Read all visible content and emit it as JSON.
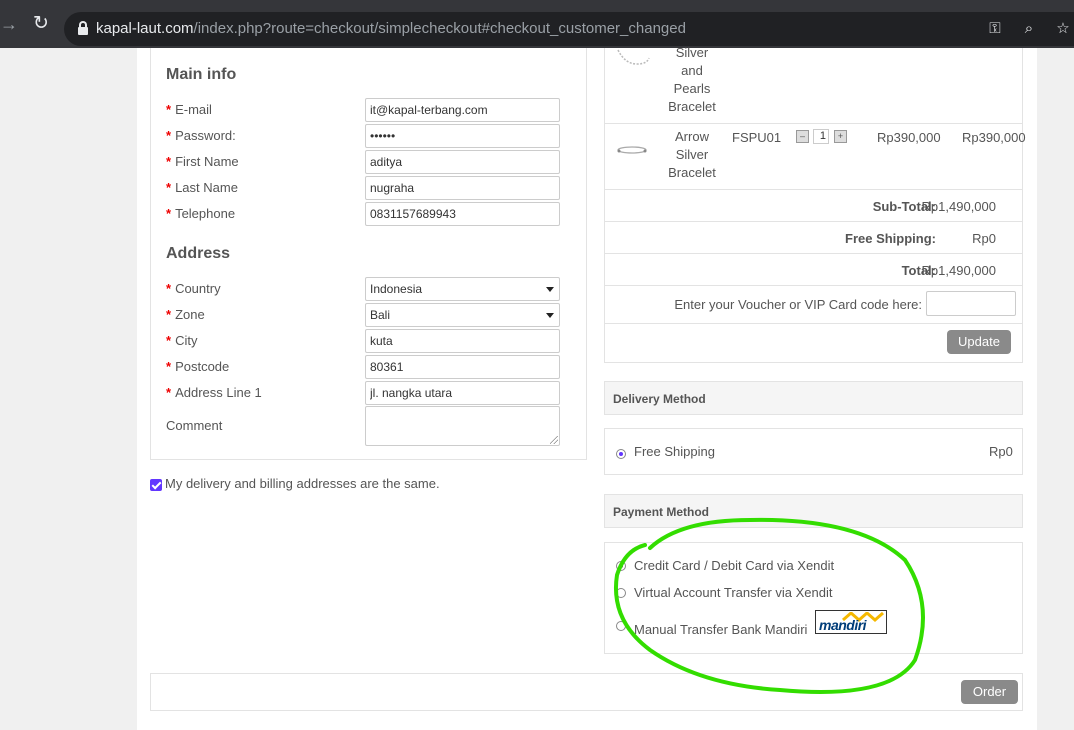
{
  "browser": {
    "url_host": "kapal-laut.com",
    "url_path": "/index.php?route=checkout/simplecheckout#checkout_customer_changed"
  },
  "main_info": {
    "title": "Main info",
    "fields": [
      {
        "label": "E-mail",
        "value": "it@kapal-terbang.com",
        "required": true
      },
      {
        "label": "Password:",
        "value": "••••••",
        "required": true
      },
      {
        "label": "First Name",
        "value": "aditya",
        "required": true
      },
      {
        "label": "Last Name",
        "value": "nugraha",
        "required": true
      },
      {
        "label": "Telephone",
        "value": "0831157689943",
        "required": true
      }
    ]
  },
  "address": {
    "title": "Address",
    "country": {
      "label": "Country",
      "value": "Indonesia"
    },
    "zone": {
      "label": "Zone",
      "value": "Bali"
    },
    "city": {
      "label": "City",
      "value": "kuta"
    },
    "postcode": {
      "label": "Postcode",
      "value": "80361"
    },
    "address1": {
      "label": "Address Line 1",
      "value": "jl. nangka utara"
    },
    "comment": {
      "label": "Comment",
      "value": ""
    }
  },
  "same_address": {
    "label": "My delivery and billing addresses are the same.",
    "checked": true
  },
  "cart": {
    "items": [
      {
        "name_lines": [
          "Silver",
          "and",
          "Pearls",
          "Bracelet"
        ]
      },
      {
        "name_lines": [
          "Arrow",
          "Silver",
          "Bracelet"
        ],
        "model": "FSPU01",
        "qty": "1",
        "price": "Rp390,000",
        "total": "Rp390,000"
      }
    ],
    "subtotal": {
      "label": "Sub-Total:",
      "value": "Rp1,490,000"
    },
    "shipping": {
      "label": "Free Shipping:",
      "value": "Rp0"
    },
    "total": {
      "label": "Total:",
      "value": "Rp1,490,000"
    },
    "voucher_label": "Enter your Voucher or VIP Card code here:",
    "update_label": "Update"
  },
  "delivery": {
    "title": "Delivery Method",
    "option": "Free Shipping",
    "cost": "Rp0"
  },
  "payment": {
    "title": "Payment Method",
    "options": [
      "Credit Card / Debit Card via Xendit",
      "Virtual Account Transfer via Xendit",
      "Manual Transfer Bank Mandiri"
    ],
    "logo_text": "mandiri"
  },
  "order_label": "Order",
  "colors": {
    "accent": "#6236ff",
    "annotation": "#33dd00",
    "button": "#8a8a8a"
  }
}
